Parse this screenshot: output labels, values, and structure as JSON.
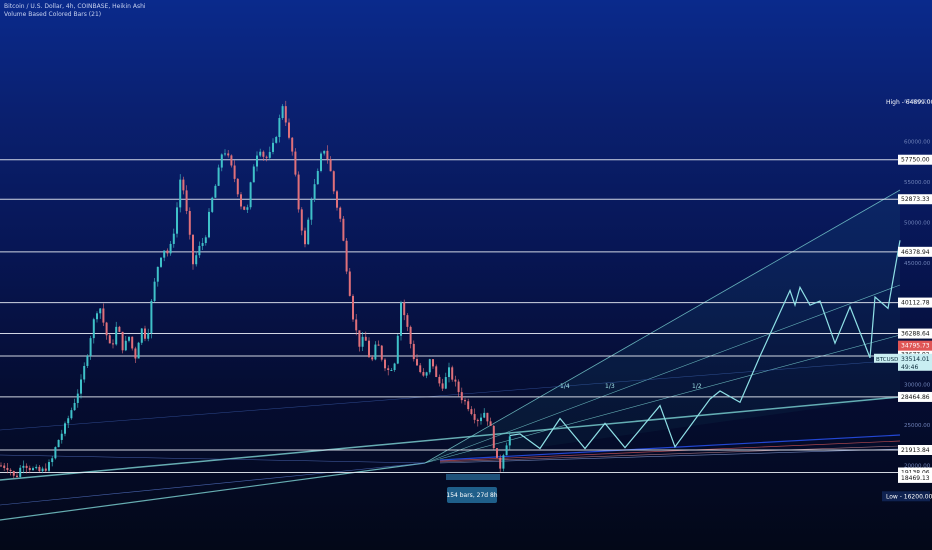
{
  "legend": {
    "title": "Bitcoin / U.S. Dollar, 4h, COINBASE, Heikin Ashi",
    "indicator": "Volume Based Colored Bars (21)"
  },
  "colors": {
    "up_candle": "#3fc1c9",
    "down_candle": "#e0707a",
    "hline": "#e8ecf5",
    "fan": "#7fd6d6",
    "pattern": "#8fe0e6",
    "current_price_tag": "#e05555",
    "ticker_tag": "#c9eef2"
  },
  "chart_data": {
    "type": "candlestick",
    "instrument": "BTCUSD",
    "ylim": [
      15000,
      66000
    ],
    "y_ticks": [
      {
        "value": 65000,
        "label": "65000.00"
      },
      {
        "value": 60000,
        "label": "60000.00"
      },
      {
        "value": 55000,
        "label": "55000.00"
      },
      {
        "value": 50000,
        "label": "50000.00"
      },
      {
        "value": 45000,
        "label": "45000.00"
      },
      {
        "value": 40000,
        "label": "40000.00"
      },
      {
        "value": 35000,
        "label": "35000.00"
      },
      {
        "value": 30000,
        "label": "30000.00"
      },
      {
        "value": 25000,
        "label": "25000.00"
      },
      {
        "value": 20000,
        "label": "20000.00"
      }
    ],
    "high": {
      "label": "High",
      "value": "64899.00"
    },
    "low": {
      "label": "Low",
      "value": "16200.00"
    },
    "horizontal_levels": [
      {
        "value": 57750.0,
        "label": "57750.00"
      },
      {
        "value": 52873.33,
        "label": "52873.33"
      },
      {
        "value": 46378.94,
        "label": "46378.94"
      },
      {
        "value": 40112.78,
        "label": "40112.78"
      },
      {
        "value": 36288.64,
        "label": "36288.64"
      },
      {
        "value": 33516.11,
        "label": "33516.11"
      },
      {
        "value": 28464.86,
        "label": "28464.86"
      },
      {
        "value": 21913.84,
        "label": "21913.84"
      },
      {
        "value": 19138.06,
        "label": "19138.06"
      }
    ],
    "unlined_labels": [
      {
        "value": 18469.13,
        "label": "18469.13"
      },
      {
        "value": 33677.92,
        "label": "33677.92"
      }
    ],
    "current_price": {
      "value": 34795.73,
      "label": "34795.73"
    },
    "ticker_tag": {
      "value": 33300,
      "symbol": "BTCUSD",
      "price": "33514.01",
      "countdown": "49:46"
    },
    "fan_labels": [
      "1/4",
      "1/3",
      "1/2"
    ],
    "range_measure": {
      "label": "154 bars, 27d 8h"
    },
    "price_path": [
      [
        0,
        20000
      ],
      [
        8,
        19800
      ],
      [
        14,
        18300
      ],
      [
        22,
        20400
      ],
      [
        30,
        19600
      ],
      [
        40,
        19200
      ],
      [
        50,
        20300
      ],
      [
        56,
        22800
      ],
      [
        64,
        24800
      ],
      [
        72,
        27400
      ],
      [
        80,
        30200
      ],
      [
        86,
        33700
      ],
      [
        92,
        37500
      ],
      [
        98,
        40100
      ],
      [
        104,
        36800
      ],
      [
        110,
        34200
      ],
      [
        116,
        37400
      ],
      [
        122,
        34400
      ],
      [
        128,
        35900
      ],
      [
        134,
        33200
      ],
      [
        140,
        37000
      ],
      [
        146,
        35500
      ],
      [
        150,
        39800
      ],
      [
        156,
        44300
      ],
      [
        162,
        46900
      ],
      [
        168,
        46000
      ],
      [
        174,
        49700
      ],
      [
        180,
        56200
      ],
      [
        186,
        50800
      ],
      [
        192,
        44900
      ],
      [
        198,
        46800
      ],
      [
        204,
        48000
      ],
      [
        210,
        52300
      ],
      [
        216,
        55300
      ],
      [
        222,
        59300
      ],
      [
        228,
        57700
      ],
      [
        234,
        55300
      ],
      [
        240,
        52200
      ],
      [
        246,
        51300
      ],
      [
        252,
        56800
      ],
      [
        258,
        59500
      ],
      [
        264,
        57800
      ],
      [
        270,
        58500
      ],
      [
        276,
        61300
      ],
      [
        282,
        64800
      ],
      [
        288,
        60200
      ],
      [
        292,
        58300
      ],
      [
        298,
        51300
      ],
      [
        304,
        47100
      ],
      [
        310,
        53000
      ],
      [
        316,
        55500
      ],
      [
        322,
        59500
      ],
      [
        328,
        57400
      ],
      [
        334,
        53000
      ],
      [
        340,
        50000
      ],
      [
        346,
        44000
      ],
      [
        352,
        38400
      ],
      [
        358,
        34900
      ],
      [
        364,
        35800
      ],
      [
        370,
        32400
      ],
      [
        376,
        35300
      ],
      [
        382,
        32800
      ],
      [
        388,
        31600
      ],
      [
        394,
        33000
      ],
      [
        400,
        40200
      ],
      [
        406,
        37200
      ],
      [
        412,
        33600
      ],
      [
        418,
        31800
      ],
      [
        424,
        30500
      ],
      [
        430,
        33500
      ],
      [
        436,
        30300
      ],
      [
        442,
        29900
      ],
      [
        448,
        31700
      ],
      [
        454,
        30100
      ],
      [
        460,
        28500
      ],
      [
        468,
        27200
      ],
      [
        476,
        25600
      ],
      [
        484,
        26700
      ],
      [
        490,
        24400
      ],
      [
        498,
        19200
      ],
      [
        504,
        22500
      ],
      [
        510,
        23800
      ]
    ],
    "projection_path": [
      [
        510,
        23700
      ],
      [
        520,
        23900
      ],
      [
        540,
        22100
      ],
      [
        560,
        25800
      ],
      [
        585,
        22100
      ],
      [
        605,
        25200
      ],
      [
        625,
        22200
      ],
      [
        660,
        27400
      ],
      [
        675,
        22300
      ],
      [
        710,
        28200
      ],
      [
        720,
        29200
      ],
      [
        740,
        27800
      ],
      [
        760,
        33500
      ],
      [
        790,
        41600
      ],
      [
        795,
        39800
      ],
      [
        800,
        42000
      ],
      [
        810,
        39800
      ],
      [
        820,
        40300
      ],
      [
        835,
        35100
      ],
      [
        850,
        39600
      ],
      [
        870,
        33300
      ],
      [
        875,
        40800
      ],
      [
        888,
        39400
      ],
      [
        900,
        47800
      ]
    ]
  }
}
